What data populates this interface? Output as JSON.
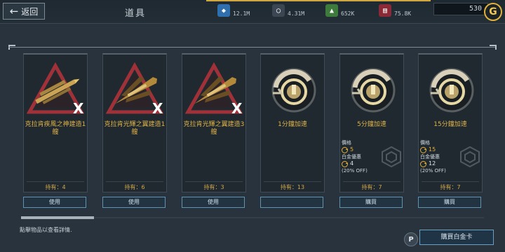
{
  "header": {
    "back_label": "返回",
    "title": "道具",
    "resources": [
      {
        "icon": "blue-crystal-icon",
        "value": "12.1M",
        "color": "#2f6fae"
      },
      {
        "icon": "energy-ring-icon",
        "value": "4.31M",
        "color": "#3b4652"
      },
      {
        "icon": "green-ore-icon",
        "value": "652K",
        "color": "#3d7a3c"
      },
      {
        "icon": "red-cargo-icon",
        "value": "75.8K",
        "color": "#8a2a37"
      }
    ],
    "gold_amount": "530"
  },
  "items": [
    {
      "name": "克拉肯疾風之神建造1艘",
      "owned": "持有：4",
      "action": "使用",
      "art": "ship-blueprint-icon"
    },
    {
      "name": "克拉肯光輝之翼建造1艘",
      "owned": "持有：6",
      "action": "使用",
      "art": "ship-blueprint-icon"
    },
    {
      "name": "克拉肯光輝之翼建造3艘",
      "owned": "持有：3",
      "action": "使用",
      "art": "ship-blueprint-icon"
    },
    {
      "name": "1分鐘加速",
      "owned": "持有：13",
      "action": "",
      "art": "speedup-gear-icon"
    },
    {
      "name": "5分鐘加速",
      "owned": "持有：7",
      "action": "購買",
      "art": "speedup-gear-icon",
      "price_label": "價格",
      "price": "5",
      "vip_label": "白金優惠",
      "vip_price": "4",
      "discount": "(20% OFF)"
    },
    {
      "name": "15分鐘加速",
      "owned": "持有：7",
      "action": "購買",
      "art": "speedup-gear-icon",
      "price_label": "價格",
      "price": "15",
      "vip_label": "白金優惠",
      "vip_price": "12",
      "discount": "(20% OFF)"
    }
  ],
  "footer": {
    "hint": "點擊物品以查看詳情.",
    "p_label": "P",
    "buy_platinum": "購買白金卡"
  },
  "colors": {
    "accent_gold": "#e0b24a",
    "button_border": "#5e93b4"
  }
}
